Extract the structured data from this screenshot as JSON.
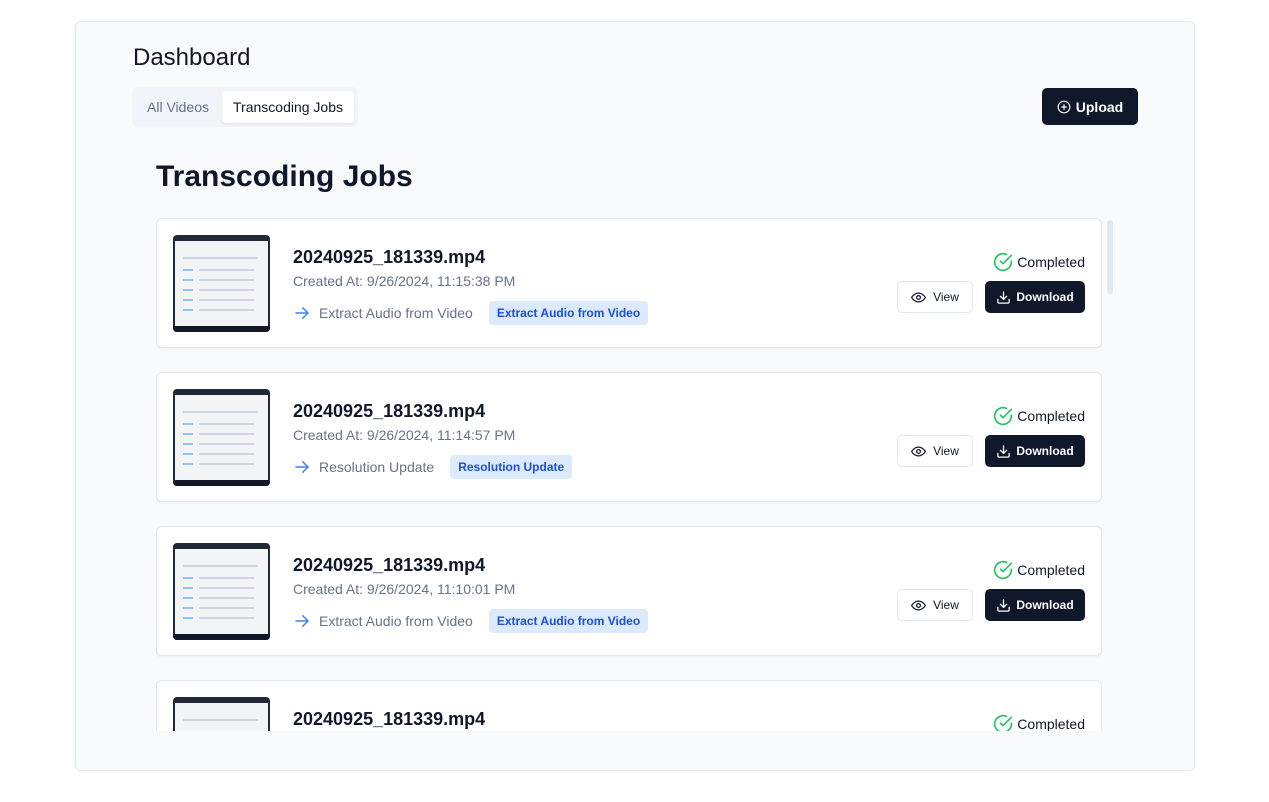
{
  "dashboard": {
    "title": "Dashboard",
    "tabs": [
      {
        "label": "All Videos",
        "active": false
      },
      {
        "label": "Transcoding Jobs",
        "active": true
      }
    ],
    "upload_label": "Upload"
  },
  "section": {
    "title": "Transcoding Jobs"
  },
  "jobs": [
    {
      "name": "20240925_181339.mp4",
      "created": "Created At: 9/26/2024, 11:15:38 PM",
      "type": "Extract Audio from Video",
      "badge": "Extract Audio from Video",
      "status": "Completed",
      "view_label": "View",
      "download_label": "Download"
    },
    {
      "name": "20240925_181339.mp4",
      "created": "Created At: 9/26/2024, 11:14:57 PM",
      "type": "Resolution Update",
      "badge": "Resolution Update",
      "status": "Completed",
      "view_label": "View",
      "download_label": "Download"
    },
    {
      "name": "20240925_181339.mp4",
      "created": "Created At: 9/26/2024, 11:10:01 PM",
      "type": "Extract Audio from Video",
      "badge": "Extract Audio from Video",
      "status": "Completed",
      "view_label": "View",
      "download_label": "Download"
    },
    {
      "name": "20240925_181339.mp4",
      "status": "Completed"
    }
  ],
  "colors": {
    "primary": "#0f172a",
    "badge_bg": "#dbeafe",
    "badge_text": "#1d4ed8",
    "success": "#22c55e",
    "arrow": "#3b82f6"
  },
  "icons": {
    "upload": "plus-circle-icon",
    "arrow": "arrow-right-icon",
    "status": "check-circle-icon",
    "view": "eye-icon",
    "download": "download-icon"
  }
}
